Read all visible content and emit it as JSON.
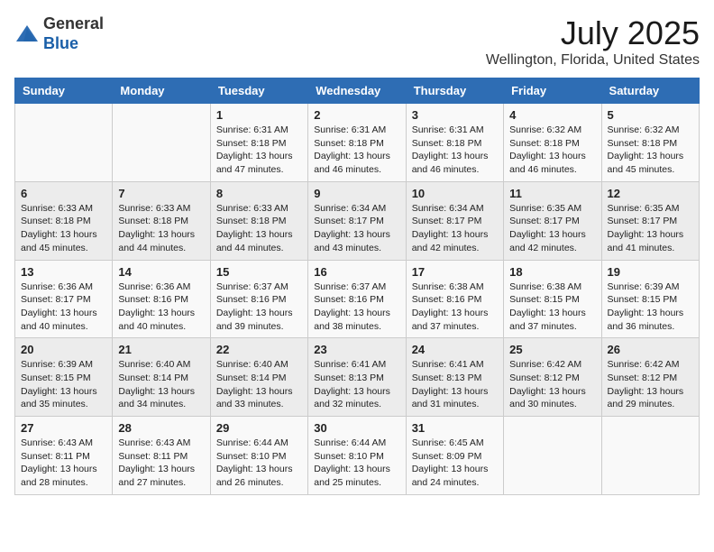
{
  "header": {
    "logo_line1": "General",
    "logo_line2": "Blue",
    "title": "July 2025",
    "subtitle": "Wellington, Florida, United States"
  },
  "days_of_week": [
    "Sunday",
    "Monday",
    "Tuesday",
    "Wednesday",
    "Thursday",
    "Friday",
    "Saturday"
  ],
  "weeks": [
    [
      {
        "day": "",
        "info": ""
      },
      {
        "day": "",
        "info": ""
      },
      {
        "day": "1",
        "info": "Sunrise: 6:31 AM\nSunset: 8:18 PM\nDaylight: 13 hours and 47 minutes."
      },
      {
        "day": "2",
        "info": "Sunrise: 6:31 AM\nSunset: 8:18 PM\nDaylight: 13 hours and 46 minutes."
      },
      {
        "day": "3",
        "info": "Sunrise: 6:31 AM\nSunset: 8:18 PM\nDaylight: 13 hours and 46 minutes."
      },
      {
        "day": "4",
        "info": "Sunrise: 6:32 AM\nSunset: 8:18 PM\nDaylight: 13 hours and 46 minutes."
      },
      {
        "day": "5",
        "info": "Sunrise: 6:32 AM\nSunset: 8:18 PM\nDaylight: 13 hours and 45 minutes."
      }
    ],
    [
      {
        "day": "6",
        "info": "Sunrise: 6:33 AM\nSunset: 8:18 PM\nDaylight: 13 hours and 45 minutes."
      },
      {
        "day": "7",
        "info": "Sunrise: 6:33 AM\nSunset: 8:18 PM\nDaylight: 13 hours and 44 minutes."
      },
      {
        "day": "8",
        "info": "Sunrise: 6:33 AM\nSunset: 8:18 PM\nDaylight: 13 hours and 44 minutes."
      },
      {
        "day": "9",
        "info": "Sunrise: 6:34 AM\nSunset: 8:17 PM\nDaylight: 13 hours and 43 minutes."
      },
      {
        "day": "10",
        "info": "Sunrise: 6:34 AM\nSunset: 8:17 PM\nDaylight: 13 hours and 42 minutes."
      },
      {
        "day": "11",
        "info": "Sunrise: 6:35 AM\nSunset: 8:17 PM\nDaylight: 13 hours and 42 minutes."
      },
      {
        "day": "12",
        "info": "Sunrise: 6:35 AM\nSunset: 8:17 PM\nDaylight: 13 hours and 41 minutes."
      }
    ],
    [
      {
        "day": "13",
        "info": "Sunrise: 6:36 AM\nSunset: 8:17 PM\nDaylight: 13 hours and 40 minutes."
      },
      {
        "day": "14",
        "info": "Sunrise: 6:36 AM\nSunset: 8:16 PM\nDaylight: 13 hours and 40 minutes."
      },
      {
        "day": "15",
        "info": "Sunrise: 6:37 AM\nSunset: 8:16 PM\nDaylight: 13 hours and 39 minutes."
      },
      {
        "day": "16",
        "info": "Sunrise: 6:37 AM\nSunset: 8:16 PM\nDaylight: 13 hours and 38 minutes."
      },
      {
        "day": "17",
        "info": "Sunrise: 6:38 AM\nSunset: 8:16 PM\nDaylight: 13 hours and 37 minutes."
      },
      {
        "day": "18",
        "info": "Sunrise: 6:38 AM\nSunset: 8:15 PM\nDaylight: 13 hours and 37 minutes."
      },
      {
        "day": "19",
        "info": "Sunrise: 6:39 AM\nSunset: 8:15 PM\nDaylight: 13 hours and 36 minutes."
      }
    ],
    [
      {
        "day": "20",
        "info": "Sunrise: 6:39 AM\nSunset: 8:15 PM\nDaylight: 13 hours and 35 minutes."
      },
      {
        "day": "21",
        "info": "Sunrise: 6:40 AM\nSunset: 8:14 PM\nDaylight: 13 hours and 34 minutes."
      },
      {
        "day": "22",
        "info": "Sunrise: 6:40 AM\nSunset: 8:14 PM\nDaylight: 13 hours and 33 minutes."
      },
      {
        "day": "23",
        "info": "Sunrise: 6:41 AM\nSunset: 8:13 PM\nDaylight: 13 hours and 32 minutes."
      },
      {
        "day": "24",
        "info": "Sunrise: 6:41 AM\nSunset: 8:13 PM\nDaylight: 13 hours and 31 minutes."
      },
      {
        "day": "25",
        "info": "Sunrise: 6:42 AM\nSunset: 8:12 PM\nDaylight: 13 hours and 30 minutes."
      },
      {
        "day": "26",
        "info": "Sunrise: 6:42 AM\nSunset: 8:12 PM\nDaylight: 13 hours and 29 minutes."
      }
    ],
    [
      {
        "day": "27",
        "info": "Sunrise: 6:43 AM\nSunset: 8:11 PM\nDaylight: 13 hours and 28 minutes."
      },
      {
        "day": "28",
        "info": "Sunrise: 6:43 AM\nSunset: 8:11 PM\nDaylight: 13 hours and 27 minutes."
      },
      {
        "day": "29",
        "info": "Sunrise: 6:44 AM\nSunset: 8:10 PM\nDaylight: 13 hours and 26 minutes."
      },
      {
        "day": "30",
        "info": "Sunrise: 6:44 AM\nSunset: 8:10 PM\nDaylight: 13 hours and 25 minutes."
      },
      {
        "day": "31",
        "info": "Sunrise: 6:45 AM\nSunset: 8:09 PM\nDaylight: 13 hours and 24 minutes."
      },
      {
        "day": "",
        "info": ""
      },
      {
        "day": "",
        "info": ""
      }
    ]
  ]
}
